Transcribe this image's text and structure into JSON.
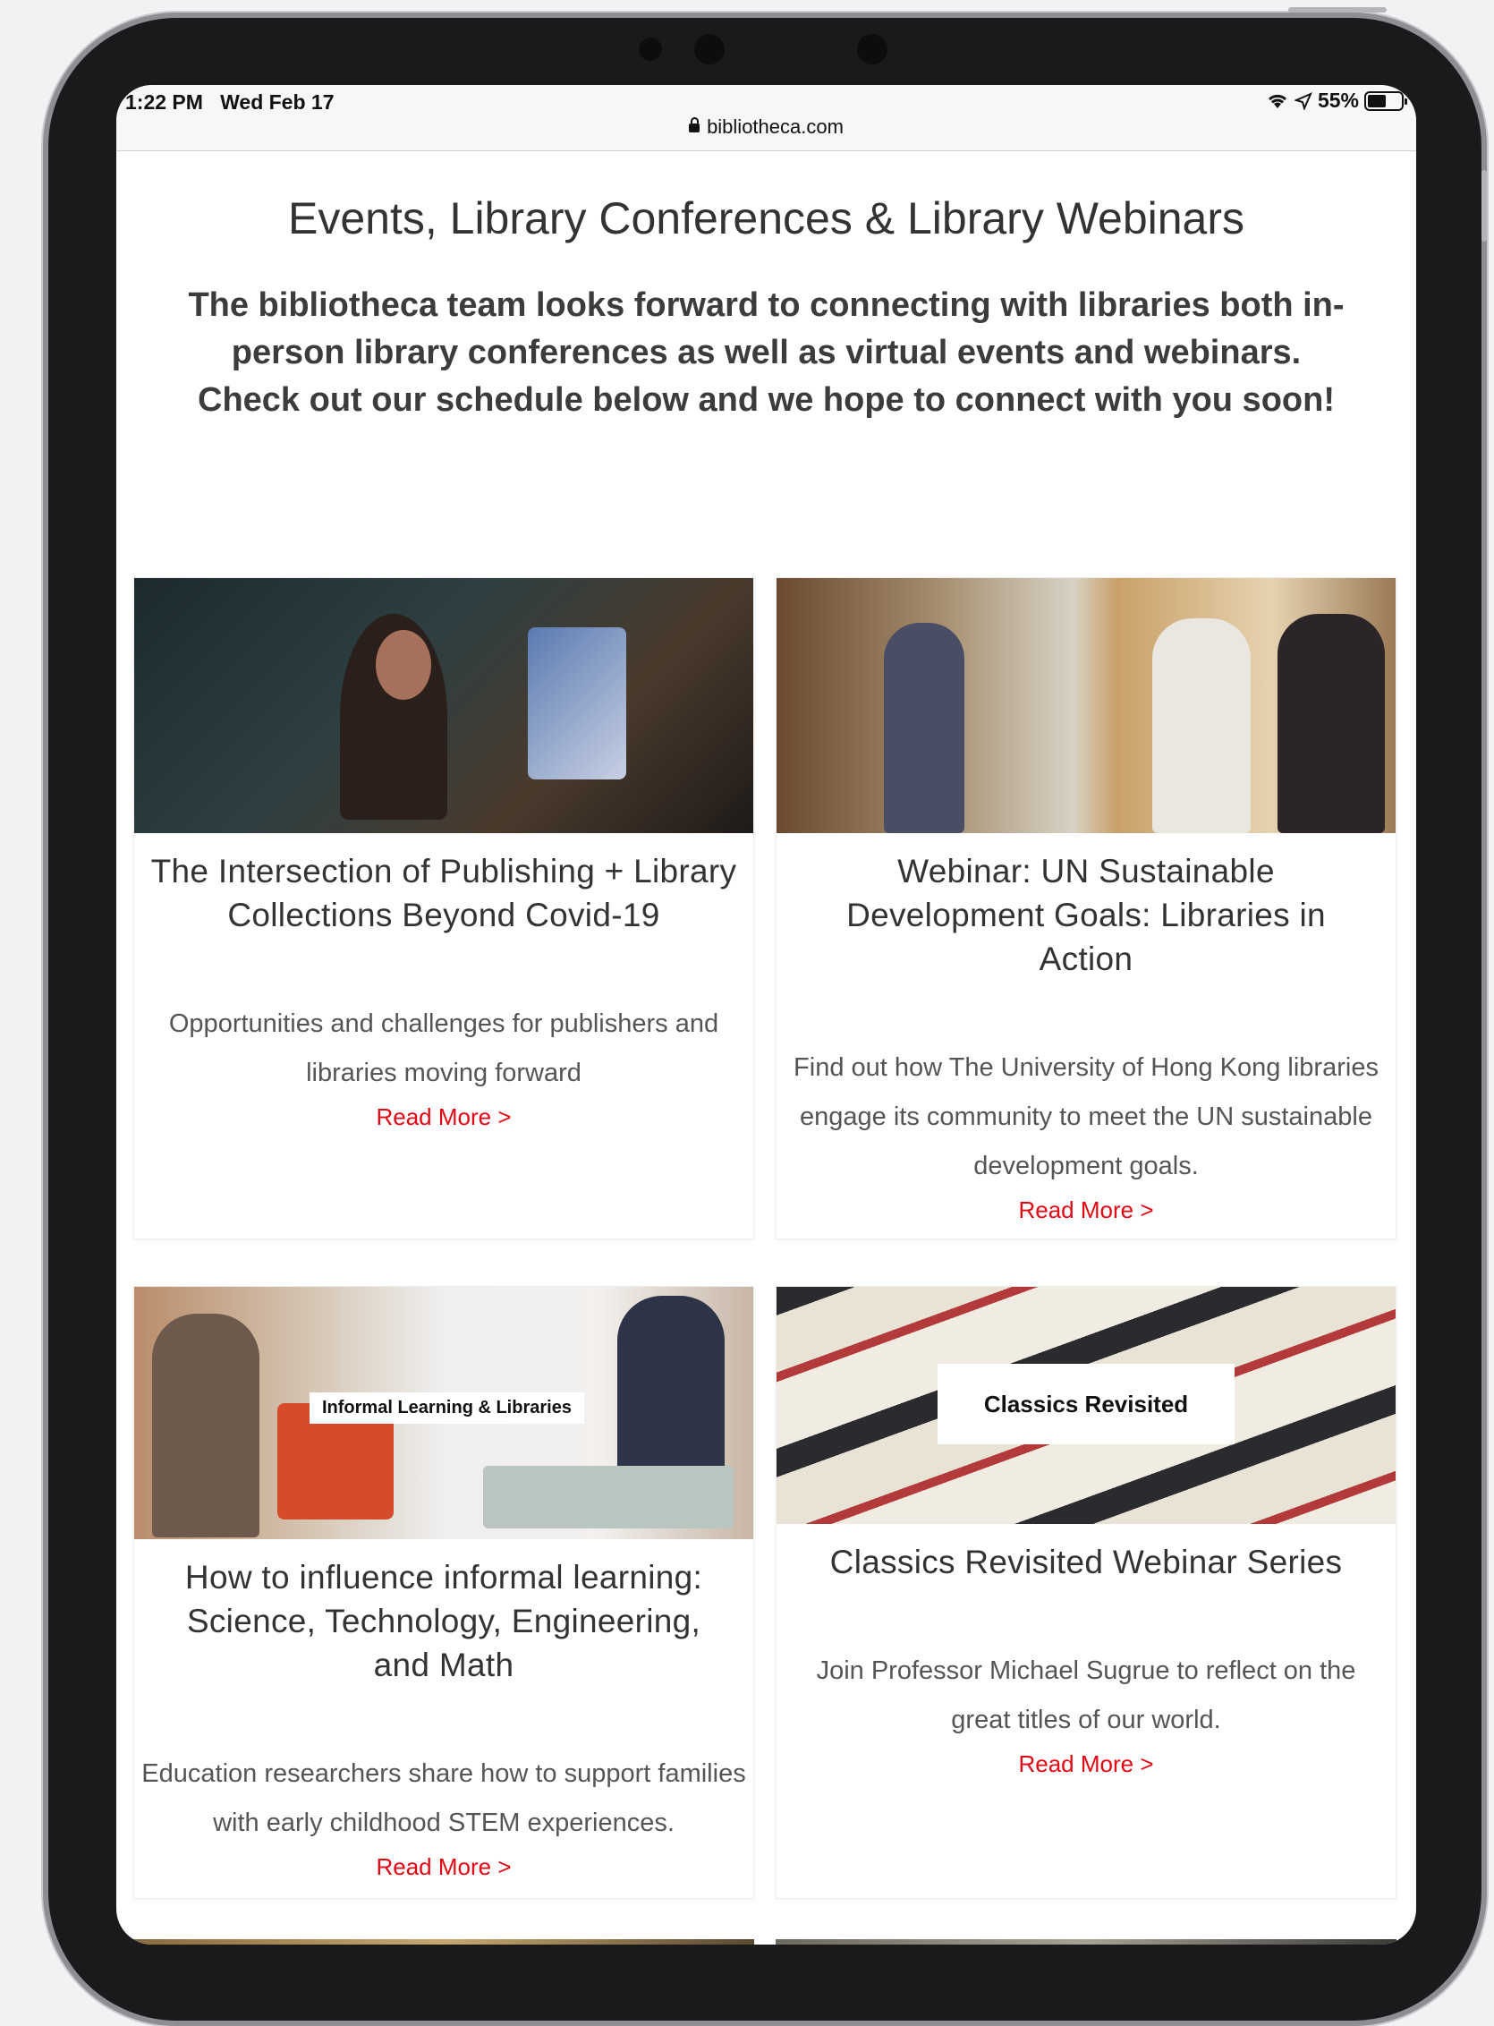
{
  "status_bar": {
    "time": "1:22 PM",
    "date": "Wed Feb 17",
    "battery": "55%",
    "battery_level": 0.55
  },
  "browser": {
    "url": "bibliotheca.com"
  },
  "page": {
    "title": "Events, Library Conferences & Library Webinars",
    "intro": "The bibliotheca team looks forward to connecting with libraries both in-person library conferences as well as virtual events and webinars. Check out our schedule below and we hope to connect with you soon!"
  },
  "cards": [
    {
      "title": "The Intersection of Publishing + Library Collections Beyond Covid-19",
      "description": "Opportunities and challenges for publishers and libraries moving forward",
      "link": "Read More >"
    },
    {
      "title": "Webinar: UN Sustainable Development Goals: Libraries in Action",
      "description": "Find out how The University of Hong Kong libraries engage its community to meet the UN sustainable development goals.",
      "link": "Read More >"
    },
    {
      "title": "How to influence informal learning: Science, Technology, Engineering, and Math",
      "description": "Education researchers share how to support families with early childhood STEM experiences.",
      "link": "Read More >",
      "image_label": "Informal Learning & Libraries"
    },
    {
      "title": "Classics Revisited Webinar Series",
      "description": "Join Professor Michael Sugrue to reflect on the great titles of our world.",
      "link": "Read More >",
      "image_label": "Classics Revisited"
    }
  ],
  "colors": {
    "link": "#e30613",
    "text": "#333333",
    "device_bezel": "#1a1a1c"
  },
  "icons": [
    "lock-icon",
    "wifi-icon",
    "location-icon",
    "battery-icon"
  ]
}
